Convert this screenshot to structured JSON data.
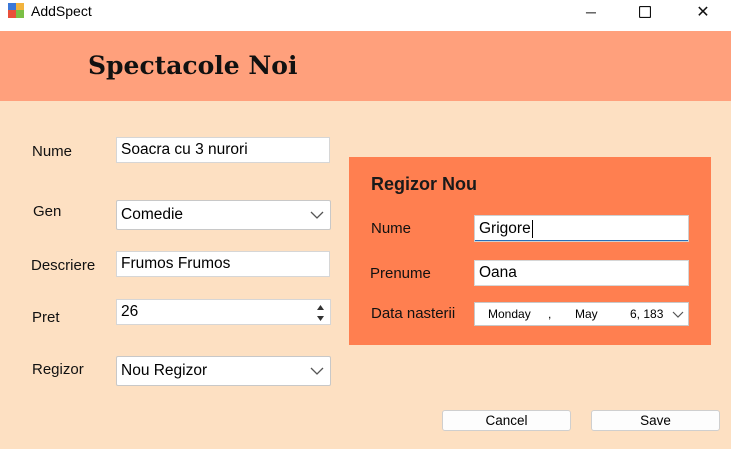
{
  "window": {
    "title": "AddSpect",
    "minimize_glyph": "─",
    "maximize_icon": "square-icon",
    "close_glyph": "✕"
  },
  "header": {
    "title": "Spectacole Noi"
  },
  "form": {
    "nume_label": "Nume",
    "nume_value": "Soacra cu 3 nurori",
    "gen_label": "Gen",
    "gen_value": "Comedie",
    "descriere_label": "Descriere",
    "descriere_value": "Frumos Frumos",
    "pret_label": "Pret",
    "pret_value": "26",
    "regizor_label": "Regizor",
    "regizor_value": "Nou Regizor"
  },
  "regizor_panel": {
    "title": "Regizor Nou",
    "nume_label": "Nume",
    "nume_value": "Grigore",
    "prenume_label": "Prenume",
    "prenume_value": "Oana",
    "data_label": "Data nasterii",
    "date_day_name": "Monday",
    "date_sep": ",",
    "date_month": "May",
    "date_day_year": "6, 183"
  },
  "buttons": {
    "cancel": "Cancel",
    "save": "Save"
  },
  "colors": {
    "background": "#fde0c2",
    "header_band": "#ffa07c",
    "panel": "#ff7f50",
    "focus_accent": "#2a6fb7"
  }
}
